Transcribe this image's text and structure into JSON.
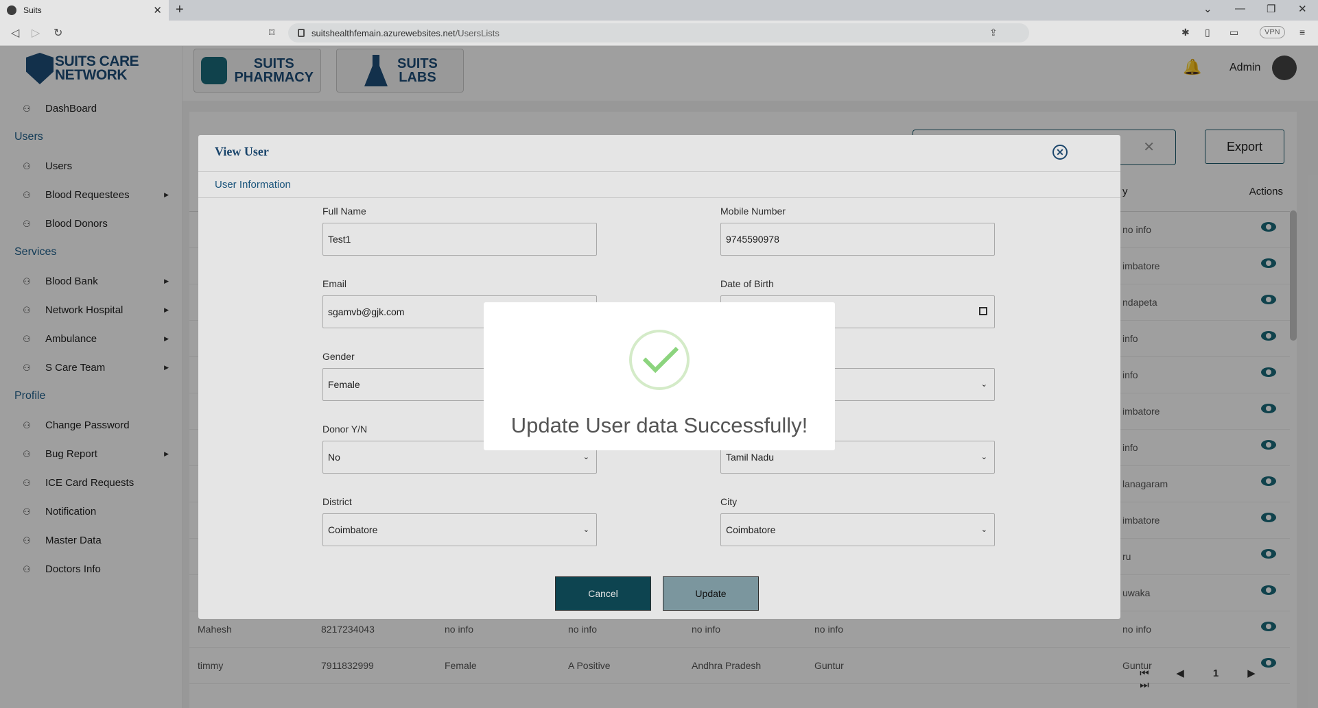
{
  "browser": {
    "tab_title": "Suits",
    "url_host": "suitshealthfemain.azurewebsites.net",
    "url_path": "/UsersLists",
    "vpn_label": "VPN"
  },
  "sidebar": {
    "logo": "SUITS CARE NETWORK",
    "items": [
      {
        "label": "DashBoard",
        "type": "item"
      },
      {
        "label": "Users",
        "type": "section"
      },
      {
        "label": "Users",
        "type": "item"
      },
      {
        "label": "Blood Requestees",
        "type": "item",
        "chevron": true
      },
      {
        "label": "Blood Donors",
        "type": "item"
      },
      {
        "label": "Services",
        "type": "section"
      },
      {
        "label": "Blood Bank",
        "type": "item",
        "chevron": true
      },
      {
        "label": "Network Hospital",
        "type": "item",
        "chevron": true
      },
      {
        "label": "Ambulance",
        "type": "item",
        "chevron": true
      },
      {
        "label": "S Care Team",
        "type": "item",
        "chevron": true
      },
      {
        "label": "Profile",
        "type": "section"
      },
      {
        "label": "Change Password",
        "type": "item"
      },
      {
        "label": "Bug Report",
        "type": "item",
        "chevron": true
      },
      {
        "label": "ICE Card Requests",
        "type": "item"
      },
      {
        "label": "Notification",
        "type": "item"
      },
      {
        "label": "Master Data",
        "type": "item"
      },
      {
        "label": "Doctors Info",
        "type": "item"
      }
    ]
  },
  "topbar": {
    "pharmacy_line1": "SUITS",
    "pharmacy_line2": "PHARMACY",
    "labs_line1": "SUITS",
    "labs_line2": "LABS",
    "user_name": "Admin"
  },
  "page": {
    "export_label": "Export",
    "actions_header": "Actions",
    "city_header": "y",
    "city_column": [
      "no info",
      "imbatore",
      "ndapeta",
      "info",
      "info",
      "imbatore",
      "info",
      "lanagaram",
      "imbatore",
      "ru",
      "uwaka"
    ],
    "rows_bottom": [
      {
        "name": "Mahesh",
        "mobile": "8217234043",
        "gender": "no info",
        "blood": "no info",
        "state": "no info",
        "district": "no info",
        "city": "no info"
      },
      {
        "name": "timmy",
        "mobile": "7911832999",
        "gender": "Female",
        "blood": "A Positive",
        "state": "Andhra Pradesh",
        "district": "Guntur",
        "city": "Guntur"
      }
    ],
    "pager_current": "1"
  },
  "modal": {
    "title": "View User",
    "subtitle": "User Information",
    "full_name_label": "Full Name",
    "full_name": "Test1",
    "mobile_label": "Mobile Number",
    "mobile": "9745590978",
    "email_label": "Email",
    "email": "sgamvb@gjk.com",
    "dob_label": "Date of Birth",
    "gender_label": "Gender",
    "gender": "Female",
    "donor_label": "Donor Y/N",
    "donor": "No",
    "state": "Tamil Nadu",
    "district_label": "District",
    "district": "Coimbatore",
    "city_label": "City",
    "city": "Coimbatore",
    "cancel_label": "Cancel",
    "update_label": "Update"
  },
  "popup": {
    "message": "Update User data Successfully!"
  }
}
